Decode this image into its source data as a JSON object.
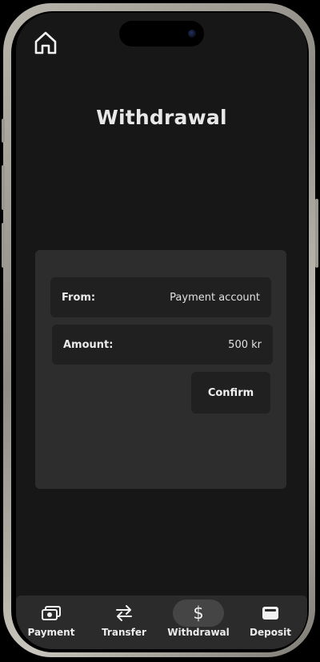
{
  "header": {
    "title": "Withdrawal",
    "home_icon": "home-icon"
  },
  "form": {
    "from_label": "From:",
    "from_value": "Payment account",
    "amount_label": "Amount:",
    "amount_value": "500 kr",
    "confirm_label": "Confirm"
  },
  "nav": {
    "items": [
      {
        "label": "Payment",
        "icon": "banknote-icon",
        "active": false
      },
      {
        "label": "Transfer",
        "icon": "transfer-arrows-icon",
        "active": false
      },
      {
        "label": "Withdrawal",
        "icon": "dollar-icon",
        "active": true
      },
      {
        "label": "Deposit",
        "icon": "wallet-icon",
        "active": false
      }
    ]
  },
  "colors": {
    "background": "#171717",
    "card": "#2d2d2d",
    "field": "#202020",
    "nav_bar": "#2b2b2b",
    "nav_active_pill": "#454545",
    "text": "#e8e8e8"
  }
}
